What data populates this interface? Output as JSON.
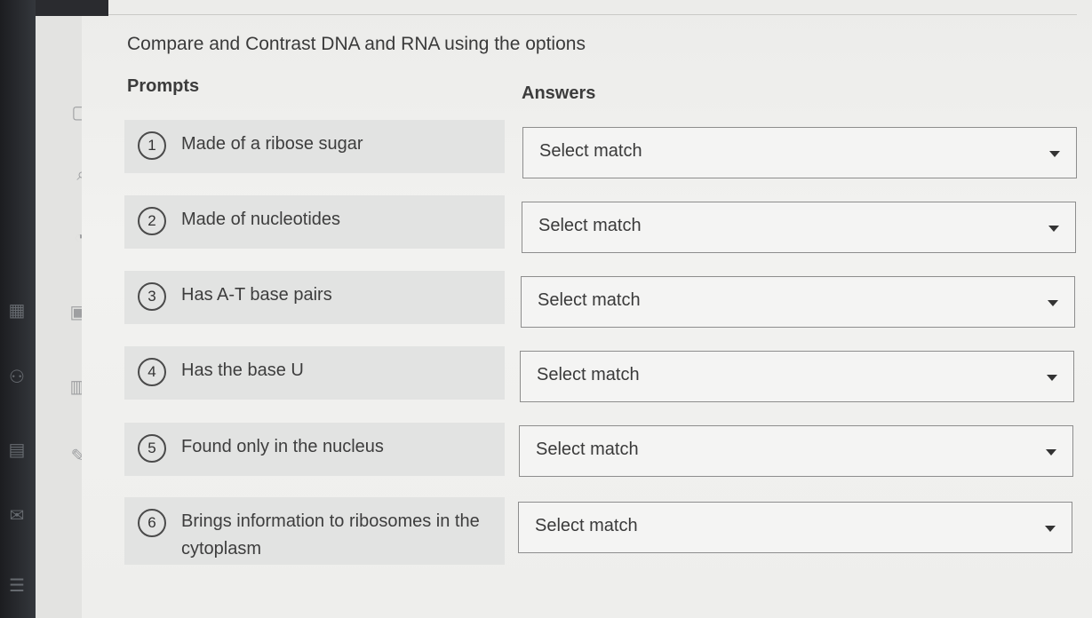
{
  "question": "Compare and Contrast DNA and RNA using the options",
  "headers": {
    "prompts": "Prompts",
    "answers": "Answers"
  },
  "prompts": [
    {
      "num": "1",
      "text": "Made of a ribose sugar"
    },
    {
      "num": "2",
      "text": "Made of nucleotides"
    },
    {
      "num": "3",
      "text": "Has A-T base pairs"
    },
    {
      "num": "4",
      "text": "Has the base U"
    },
    {
      "num": "5",
      "text": "Found only in the nucleus"
    },
    {
      "num": "6",
      "text": "Brings information to ribosomes in the cytoplasm"
    }
  ],
  "answers": [
    {
      "value": "Select match"
    },
    {
      "value": "Select match"
    },
    {
      "value": "Select match"
    },
    {
      "value": "Select match"
    },
    {
      "value": "Select match"
    },
    {
      "value": "Select match"
    }
  ]
}
